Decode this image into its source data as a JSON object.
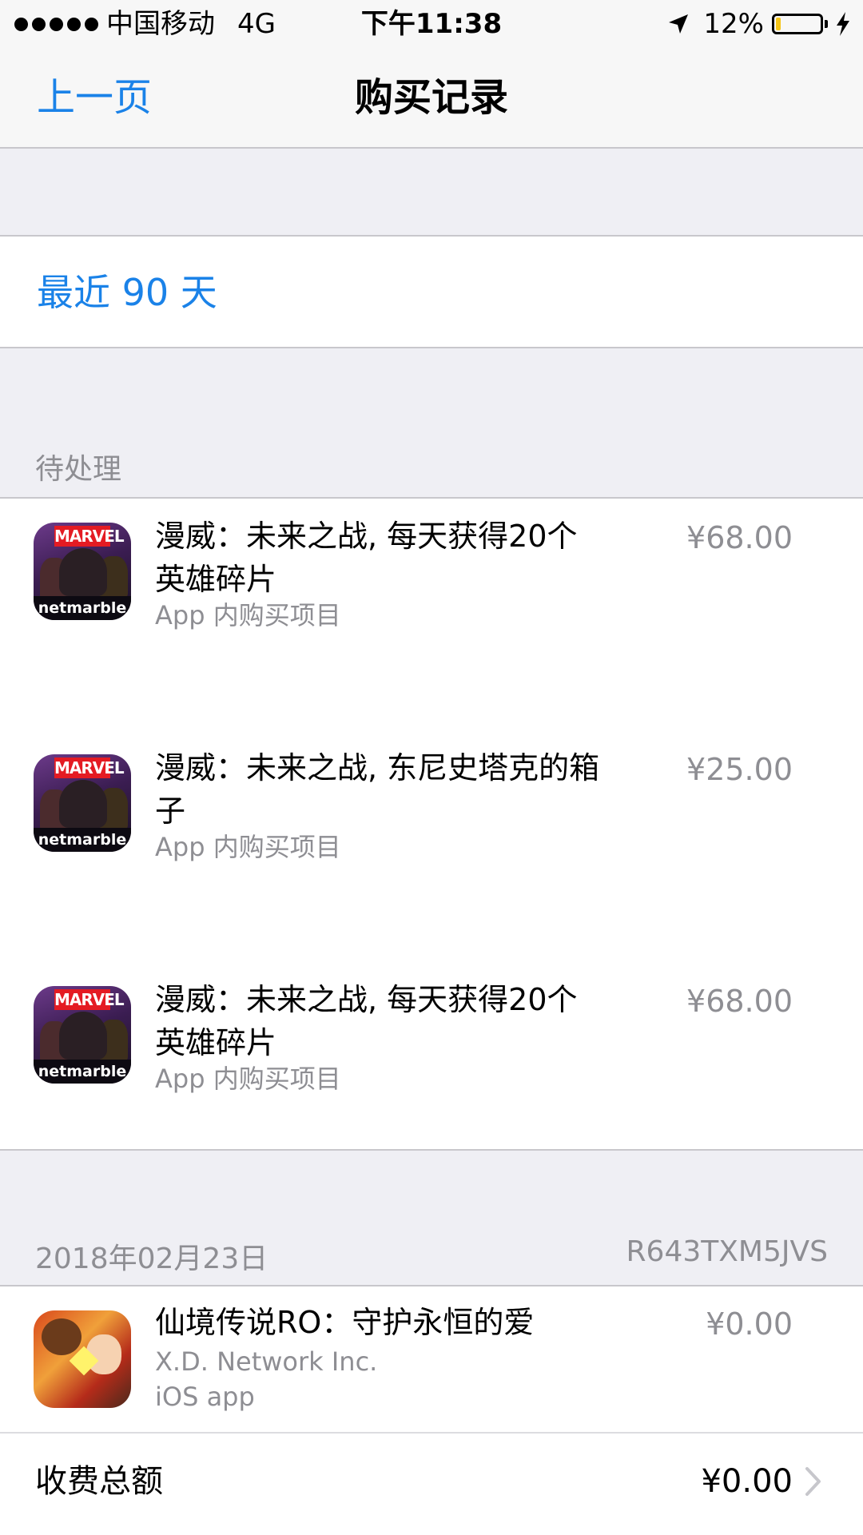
{
  "status_bar": {
    "carrier": "中国移动",
    "network": "4G",
    "time": "下午11:38",
    "battery_percent_text": "12%",
    "battery_level": 0.12,
    "battery_color": "#f5c518"
  },
  "nav": {
    "back_label": "上一页",
    "title": "购买记录"
  },
  "filter": {
    "period_label": "最近 90 天"
  },
  "pending": {
    "header": "待处理",
    "items": [
      {
        "title": "漫威：未来之战, 每天获得20个英雄碎片",
        "subtitle": "App 内购买项目",
        "price": "¥68.00",
        "icon": "marvel-future-fight-icon"
      },
      {
        "title": "漫威：未来之战, 东尼史塔克的箱子",
        "subtitle": "App 内购买项目",
        "price": "¥25.00",
        "icon": "marvel-future-fight-icon"
      },
      {
        "title": "漫威：未来之战, 每天获得20个英雄碎片",
        "subtitle": "App 内购买项目",
        "price": "¥68.00",
        "icon": "marvel-future-fight-icon"
      }
    ],
    "icon_labels": {
      "marvel": "MARVEL",
      "netmarble": "netmarble"
    }
  },
  "order": {
    "date": "2018年02月23日",
    "order_id": "R643TXM5JVS",
    "item": {
      "title": "仙境传说RO：守护永恒的爱",
      "developer": "X.D. Network Inc.",
      "type": "iOS app",
      "price": "¥0.00",
      "icon": "ragnarok-online-icon"
    },
    "total_label": "收费总额",
    "total_value": "¥0.00"
  },
  "colors": {
    "link_blue": "#1a82e8",
    "secondary_gray": "#8e8e93",
    "background": "#efeff4"
  }
}
